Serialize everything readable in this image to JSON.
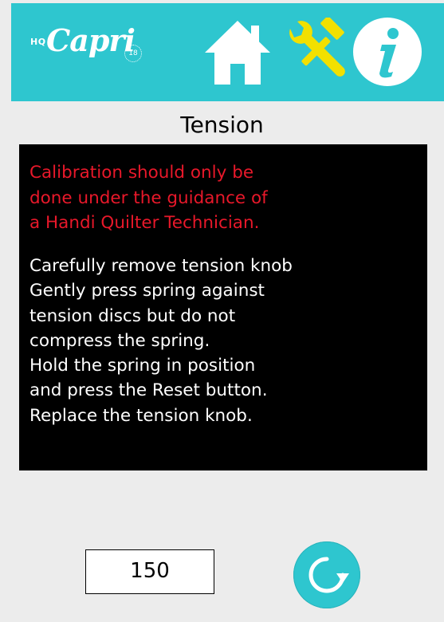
{
  "header": {
    "logo_prefix": "HQ",
    "logo_name": "Capri",
    "logo_model": "18",
    "icons": [
      "home-icon",
      "tools-icon",
      "info-icon"
    ]
  },
  "title": "Tension",
  "warning_lines": [
    "Calibration should only be",
    "done under the guidance of",
    "a Handi Quilter Technician."
  ],
  "instruction_lines": [
    "Carefully remove tension knob",
    "Gently press spring against",
    "tension discs but do not",
    "compress the spring.",
    "Hold the spring in position",
    "and press the Reset button.",
    "Replace the tension knob."
  ],
  "value": "150",
  "reset_icon": "refresh-icon",
  "colors": {
    "header": "#2ec6cf",
    "warning_text": "#e8182a",
    "tools_icon": "#f2e000",
    "background": "#ececec"
  }
}
